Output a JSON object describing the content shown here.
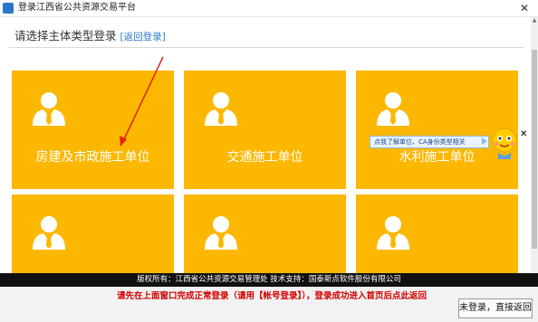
{
  "window": {
    "title": "登录江西省公共资源交易平台",
    "close": "✕"
  },
  "heading": {
    "text": "请选择主体类型登录",
    "back_link": "[返回登录]"
  },
  "cards": [
    {
      "label": "房建及市政施工单位"
    },
    {
      "label": "交通施工单位"
    },
    {
      "label": "水利施工单位"
    },
    {
      "label": ""
    },
    {
      "label": ""
    },
    {
      "label": ""
    }
  ],
  "tooltip": {
    "text": "点我了解单位、CA身份类型相关"
  },
  "mascot_close": "✕",
  "footer": {
    "copyright": "版权所有：江西省公共资源交易管理处 技术支持：国泰新点软件股份有限公司",
    "notice": "请先在上面窗口完成正常登录（请用【帐号登录】），登录成功进入首页后点此返回",
    "enter_button": "未登录，直接返回"
  },
  "colors": {
    "card": "#fcb700",
    "link": "#2a77c9",
    "notice": "#d10000",
    "footer_bar": "#111111"
  },
  "icons": {
    "person": "person-silhouette-icon",
    "mascot": "mascot-character-icon",
    "arrow": "red-arrow-annotation"
  }
}
